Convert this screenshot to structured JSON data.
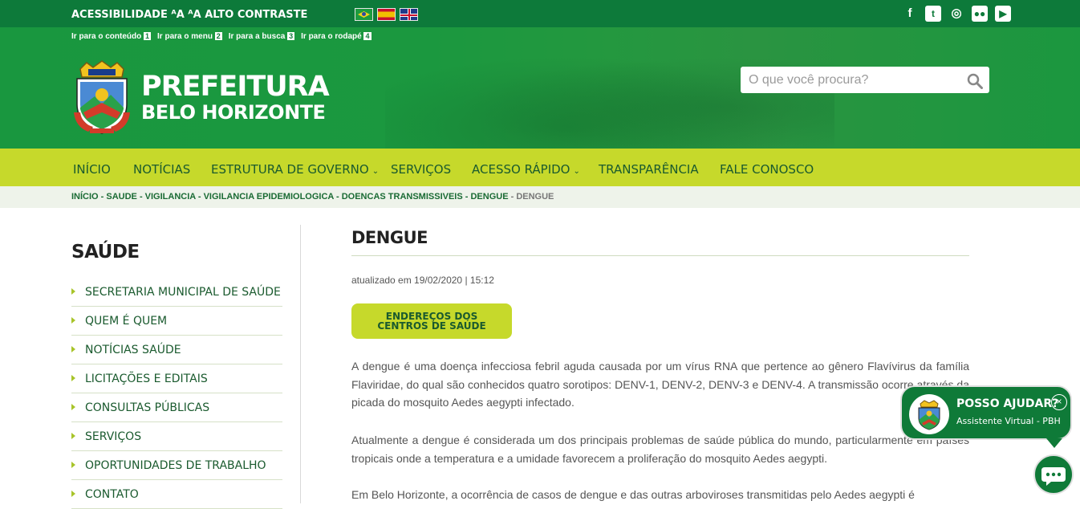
{
  "topbar": {
    "accessibility": "ACESSIBILIDADE ᴬA ᴬA ALTO CONTRASTE",
    "flags": [
      "br-flag",
      "es-flag",
      "uk-flag"
    ],
    "social": [
      "f",
      "t",
      "◎",
      "●●",
      "▶"
    ]
  },
  "skip_links": [
    {
      "label": "Ir para o conteúdo",
      "key": "1"
    },
    {
      "label": "Ir para o menu",
      "key": "2"
    },
    {
      "label": "Ir para a busca",
      "key": "3"
    },
    {
      "label": "Ir para o rodapé",
      "key": "4"
    }
  ],
  "logo": {
    "line1": "PREFEITURA",
    "line2": "BELO HORIZONTE"
  },
  "search": {
    "placeholder": "O que você procura?"
  },
  "nav": {
    "items": [
      "INÍCIO",
      "NOTÍCIAS",
      "ESTRUTURA DE GOVERNO",
      "SERVIÇOS",
      "ACESSO RÁPIDO",
      "TRANSPARÊNCIA",
      "FALE CONOSCO"
    ],
    "chevron": "⌄"
  },
  "breadcrumb": {
    "path": "INÍCIO - SAUDE - VIGILANCIA - VIGILANCIA EPIDEMIOLOGICA - DOENCAS TRANSMISSIVEIS - DENGUE",
    "current": "- DENGUE"
  },
  "sidebar": {
    "title": "SAÚDE",
    "items": [
      "SECRETARIA MUNICIPAL DE SAÚDE",
      "QUEM É QUEM",
      "NOTÍCIAS SAÚDE",
      "LICITAÇÕES E EDITAIS",
      "CONSULTAS PÚBLICAS",
      "SERVIÇOS",
      "OPORTUNIDADES DE TRABALHO",
      "CONTATO"
    ]
  },
  "main": {
    "title": "DENGUE",
    "updated": "atualizado em 19/02/2020 | 15:12",
    "cta_line1": "ENDEREÇOS DOS",
    "cta_line2": "CENTROS DE SAÚDE",
    "p1": "A dengue é uma doença infecciosa febril aguda causada por um vírus RNA que pertence ao gênero Flavívirus da família Flaviridae, do qual são conhecidos quatro sorotipos: DENV-1, DENV-2, DENV-3 e DENV-4. A transmissão ocorre através da picada do mosquito Aedes aegypti infectado.",
    "p2": "Atualmente a dengue é considerada um dos principais problemas de saúde pública do mundo, particularmente em países tropicais onde a temperatura e a umidade favorecem a proliferação do mosquito Aedes aegypti.",
    "p3": "Em Belo Horizonte, a ocorrência de casos de dengue e das outras arboviroses transmitidas pelo Aedes aegypti é"
  },
  "chat": {
    "title": "POSSO AJUDAR?",
    "subtitle": "Assistente Virtual - PBH",
    "close": "×"
  },
  "colors": {
    "dark_green": "#0d7a3a",
    "header_green": "#1b983f",
    "lime": "#c6d92b",
    "text_green": "#1a5a2e"
  }
}
